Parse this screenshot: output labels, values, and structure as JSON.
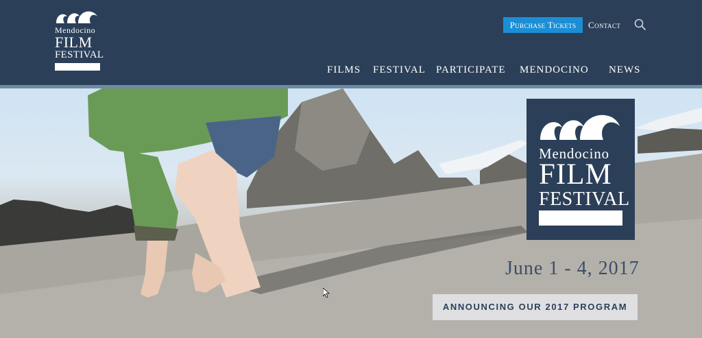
{
  "site": {
    "logo_line1": "Mendocino",
    "logo_line2": "FILM",
    "logo_line3": "FESTIVAL"
  },
  "header": {
    "purchase_label": "Purchase Tickets",
    "contact_label": "Contact",
    "search_icon": "search-icon"
  },
  "nav": [
    {
      "label": "FILMS"
    },
    {
      "label": "FESTIVAL"
    },
    {
      "label": "PARTICIPATE"
    },
    {
      "label": "MENDOCINO"
    },
    {
      "label": "NEWS"
    }
  ],
  "hero": {
    "logo_line1": "Mendocino",
    "logo_line2": "FILM",
    "logo_line3": "FESTIVAL",
    "dates": "June 1 - 4, 2017",
    "cta_label": "ANNOUNCING OUR 2017 PROGRAM"
  },
  "colors": {
    "header_bg": "#2b3f58",
    "accent": "#1a8fd6"
  }
}
